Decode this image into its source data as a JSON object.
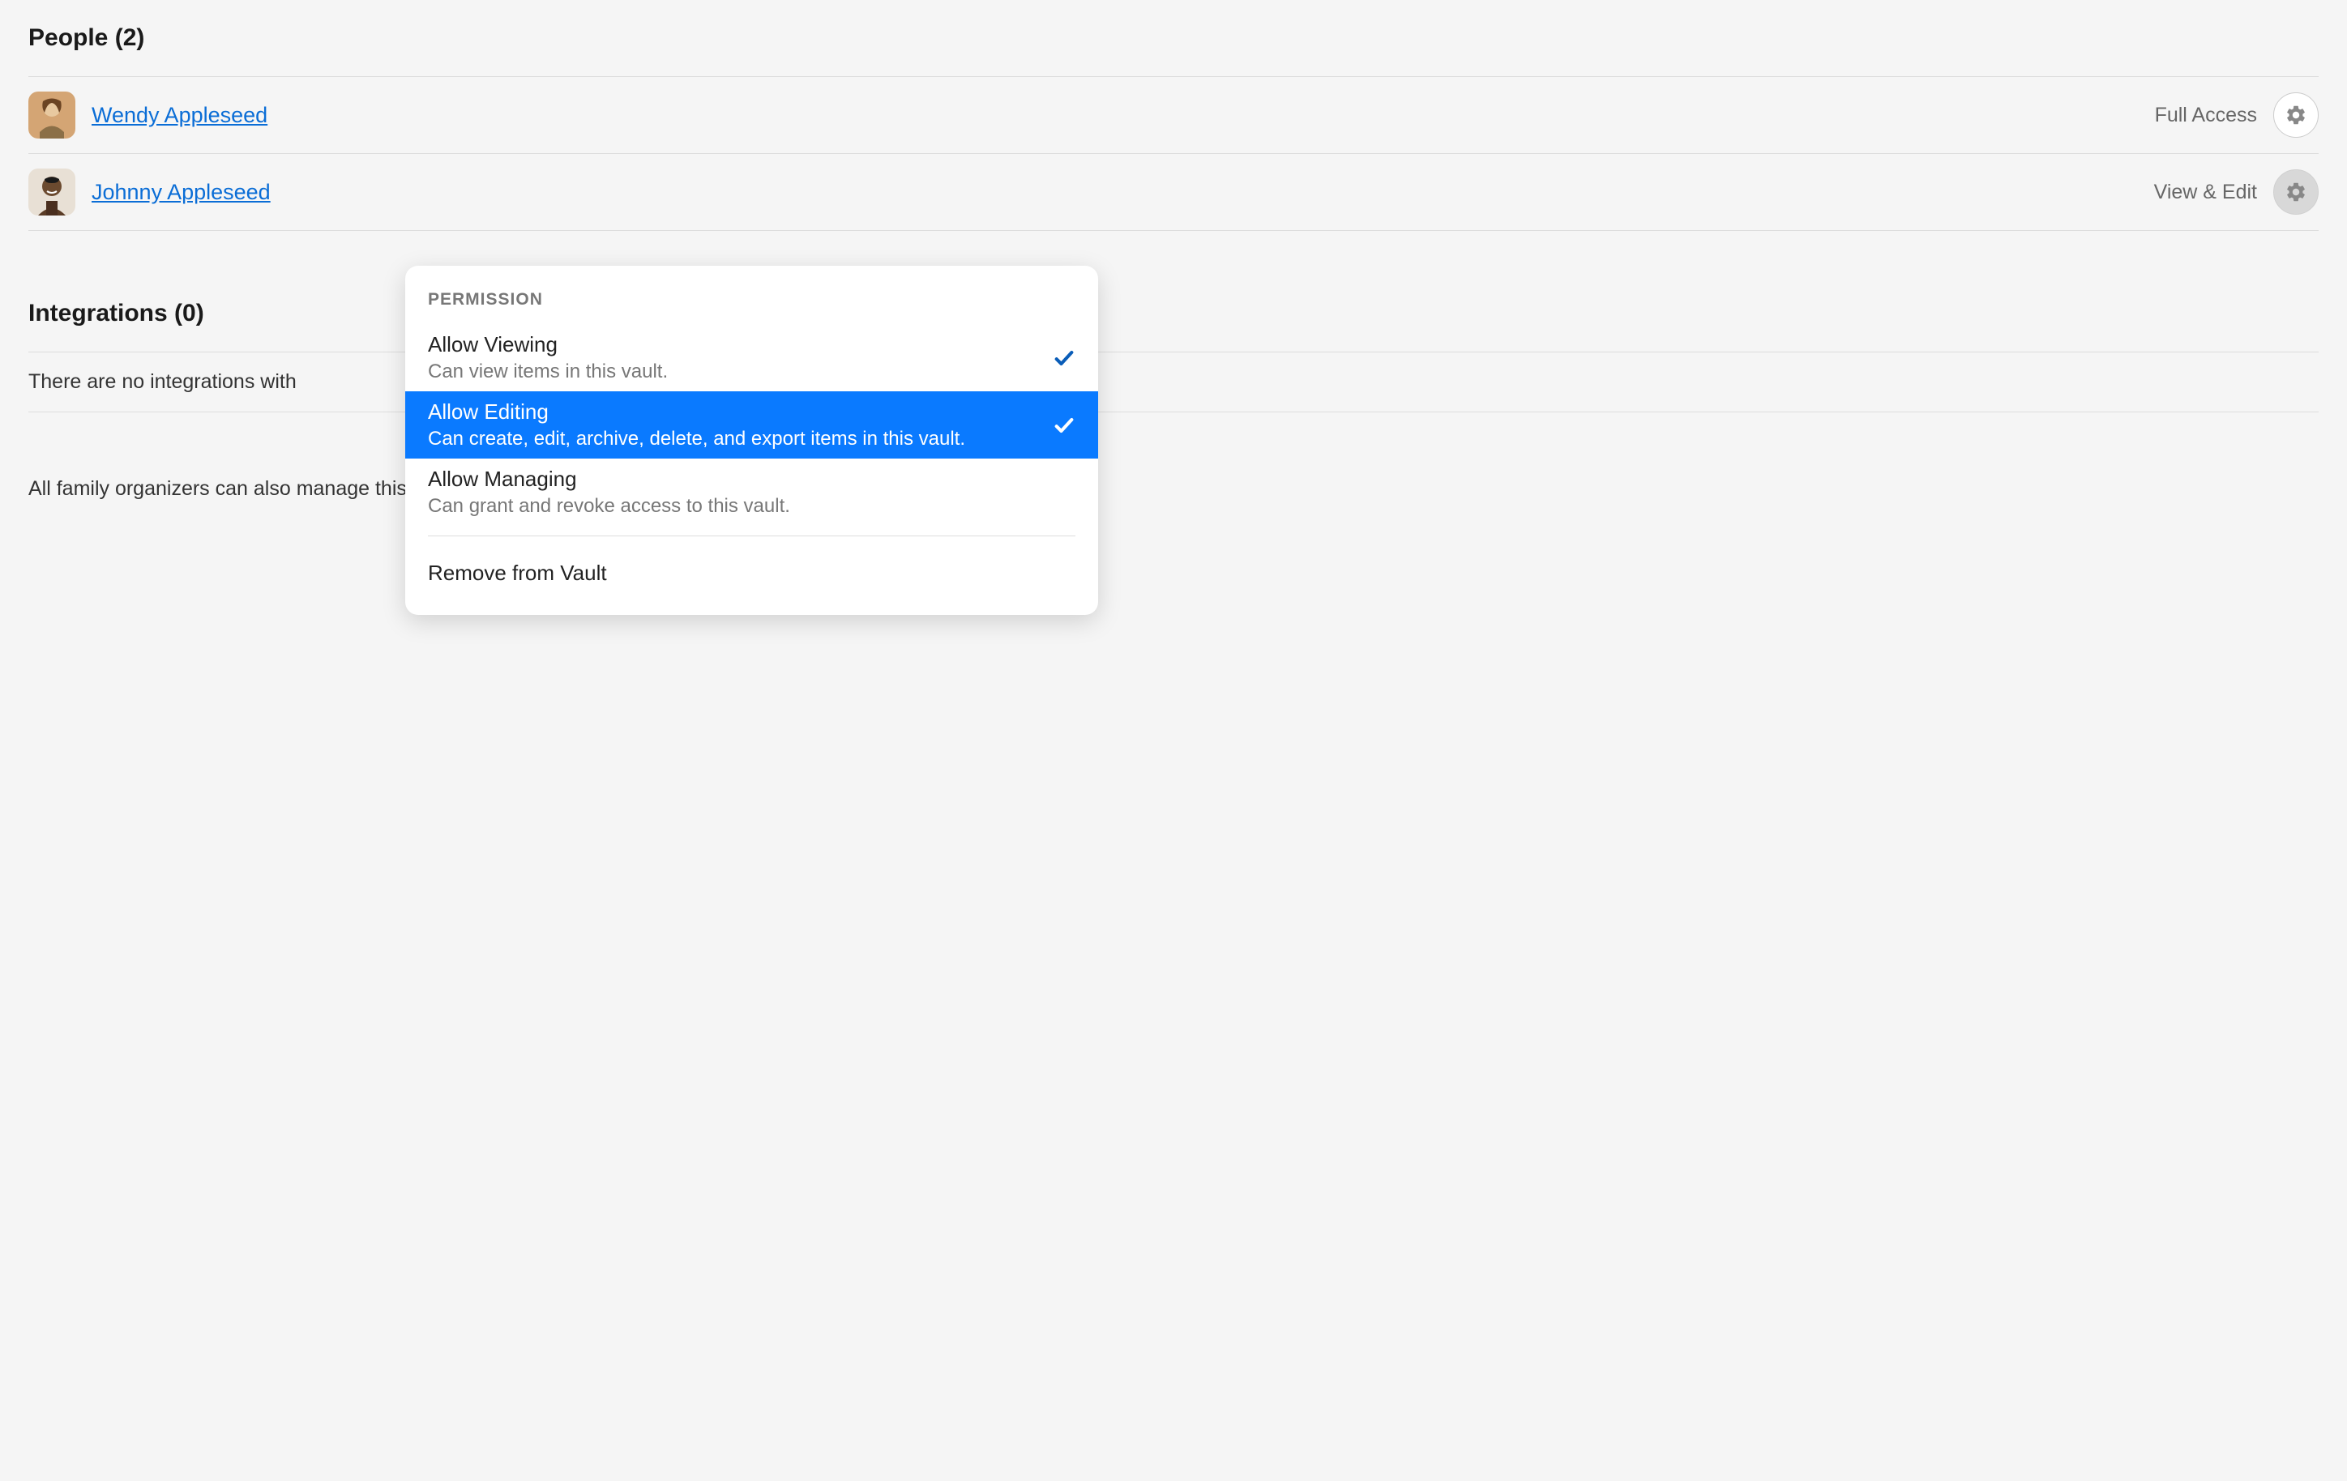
{
  "sections": {
    "people": {
      "heading": "People (2)",
      "members": [
        {
          "name": "Wendy Appleseed",
          "access": "Full Access",
          "gear_active": false
        },
        {
          "name": "Johnny Appleseed",
          "access": "View & Edit",
          "gear_active": true
        }
      ]
    },
    "integrations": {
      "heading": "Integrations (0)",
      "empty_text": "There are no integrations with"
    }
  },
  "footer": "All family organizers can also manage this vault.",
  "dropdown": {
    "header": "PERMISSION",
    "items": [
      {
        "title": "Allow Viewing",
        "desc": "Can view items in this vault.",
        "checked": true,
        "selected": false
      },
      {
        "title": "Allow Editing",
        "desc": "Can create, edit, archive, delete, and export items in this vault.",
        "checked": true,
        "selected": true
      },
      {
        "title": "Allow Managing",
        "desc": "Can grant and revoke access to this vault.",
        "checked": false,
        "selected": false
      }
    ],
    "remove_label": "Remove from Vault"
  }
}
